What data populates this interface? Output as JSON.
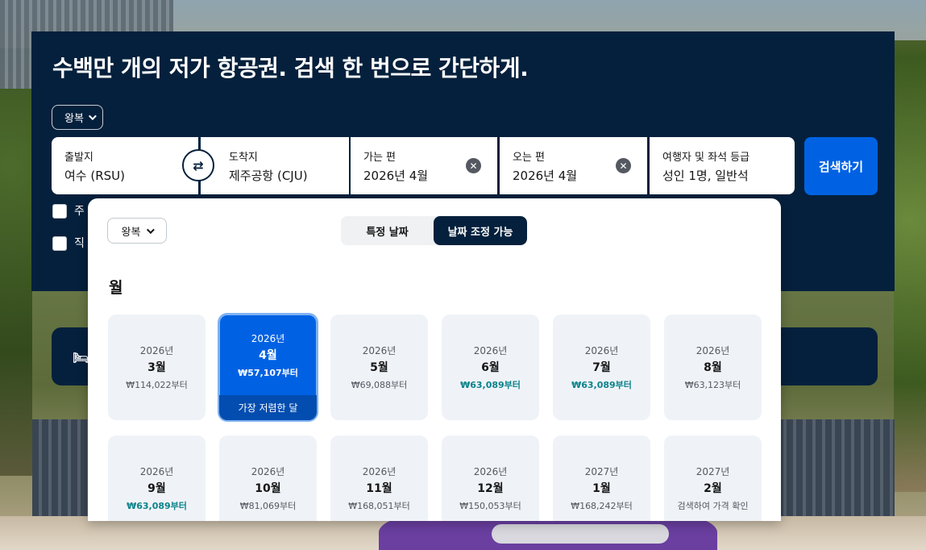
{
  "hero": {
    "title": "수백만 개의 저가 항공권. 검색 한 번으로 간단하게.",
    "trip_type": "왕복"
  },
  "search": {
    "origin_label": "출발지",
    "origin_value": "여수 (RSU)",
    "dest_label": "도착지",
    "dest_value": "제주공항 (CJU)",
    "depart_label": "가는 편",
    "depart_value": "2026년 4월",
    "return_label": "오는 편",
    "return_value": "2026년 4월",
    "pax_label": "여행자 및 좌석 등급",
    "pax_value": "성인 1명, 일반석",
    "search_button": "검색하기"
  },
  "checkboxes": [
    {
      "label": "주"
    },
    {
      "label": "직"
    }
  ],
  "popup": {
    "trip_type": "왕복",
    "toggle_specific": "특정 날짜",
    "toggle_flexible": "날짜 조정 가능",
    "heading": "월",
    "cheapest_badge": "가장 저렴한 달",
    "months": [
      {
        "year": "2026년",
        "month": "3월",
        "price": "₩114,022부터",
        "cheap": false,
        "selected": false
      },
      {
        "year": "2026년",
        "month": "4월",
        "price": "₩57,107부터",
        "cheap": false,
        "selected": true
      },
      {
        "year": "2026년",
        "month": "5월",
        "price": "₩69,088부터",
        "cheap": false,
        "selected": false
      },
      {
        "year": "2026년",
        "month": "6월",
        "price": "₩63,089부터",
        "cheap": true,
        "selected": false
      },
      {
        "year": "2026년",
        "month": "7월",
        "price": "₩63,089부터",
        "cheap": true,
        "selected": false
      },
      {
        "year": "2026년",
        "month": "8월",
        "price": "₩63,123부터",
        "cheap": false,
        "selected": false
      },
      {
        "year": "2026년",
        "month": "9월",
        "price": "₩63,089부터",
        "cheap": true,
        "selected": false
      },
      {
        "year": "2026년",
        "month": "10월",
        "price": "₩81,069부터",
        "cheap": false,
        "selected": false
      },
      {
        "year": "2026년",
        "month": "11월",
        "price": "₩168,051부터",
        "cheap": false,
        "selected": false
      },
      {
        "year": "2026년",
        "month": "12월",
        "price": "₩150,053부터",
        "cheap": false,
        "selected": false
      },
      {
        "year": "2027년",
        "month": "1월",
        "price": "₩168,242부터",
        "cheap": false,
        "selected": false
      },
      {
        "year": "2027년",
        "month": "2월",
        "price": "검색하여 가격 확인",
        "cheap": false,
        "selected": false
      }
    ]
  },
  "icons": {
    "swap": "swap-arrows-icon",
    "clear": "clear-x-icon",
    "bed": "bed-icon"
  },
  "colors": {
    "navy": "#05203c",
    "primary": "#0062e3",
    "teal_price": "#0c838a"
  }
}
